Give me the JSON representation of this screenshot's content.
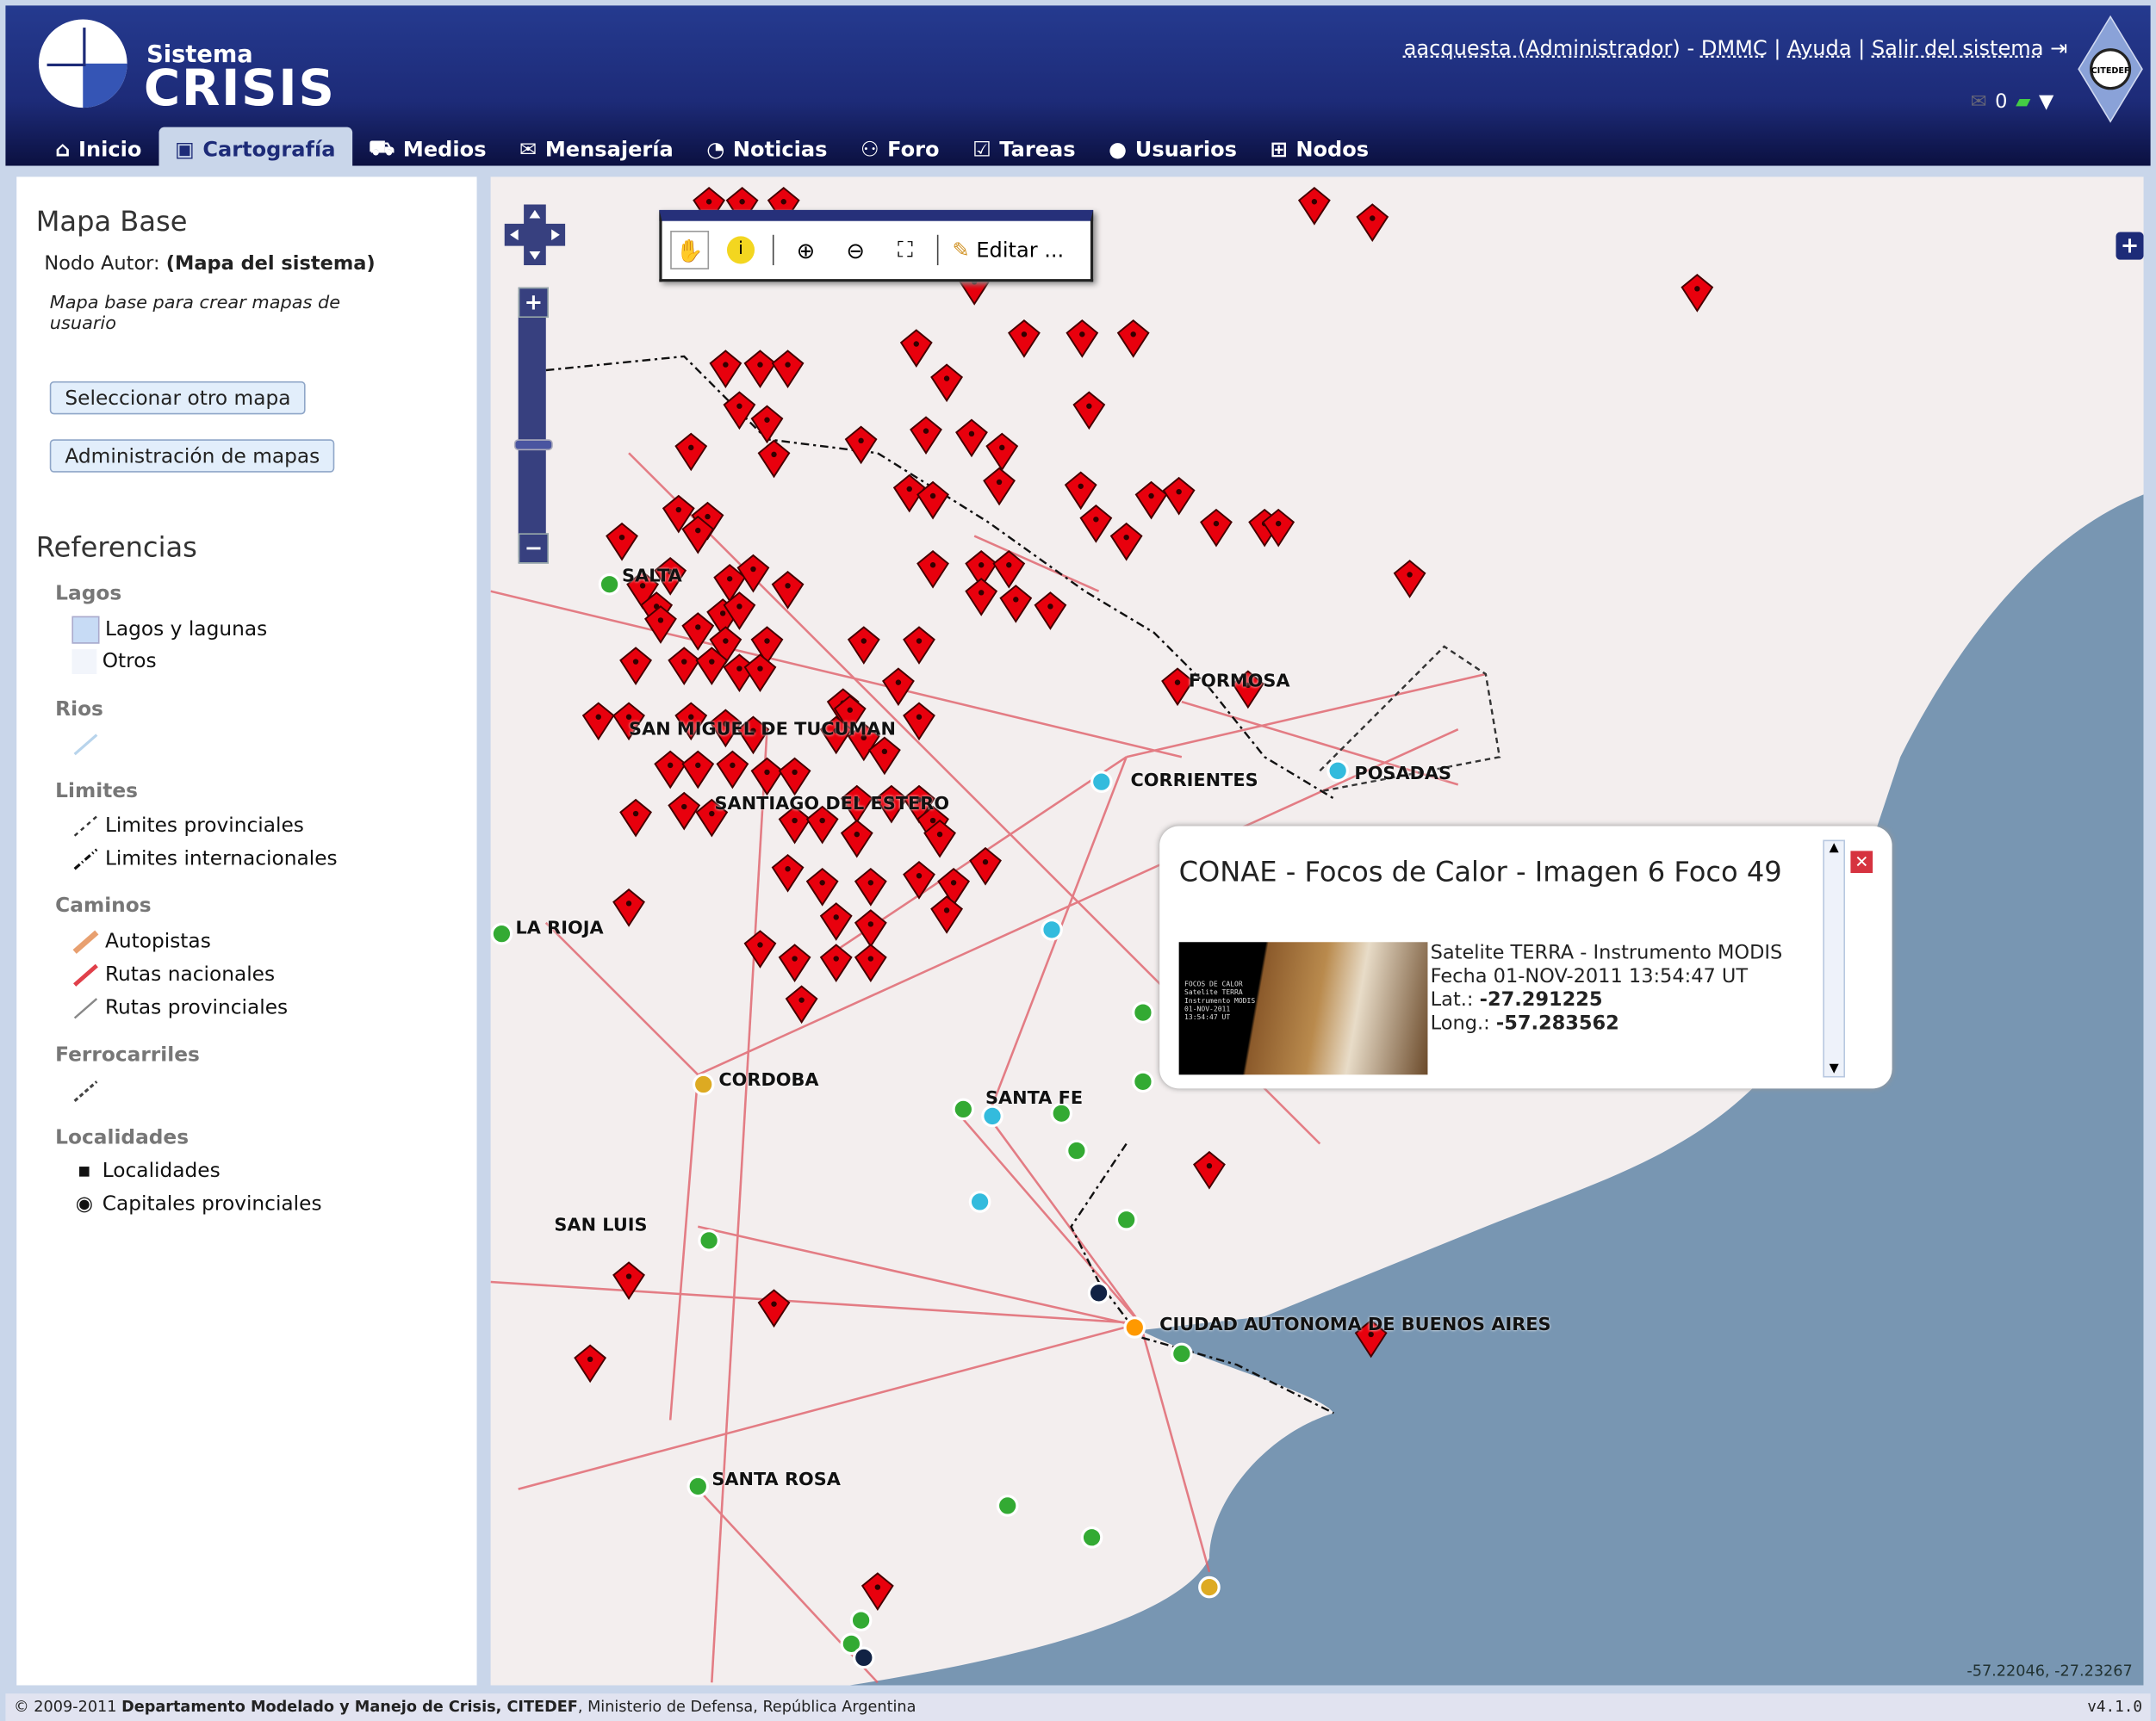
{
  "header": {
    "brand_small": "Sistema",
    "brand_big": "CRISIS",
    "user": "aacquesta (Administrador)",
    "node": "DMMC",
    "help": "Ayuda",
    "logout": "Salir del sistema",
    "separator1": " - ",
    "separator2": " | ",
    "messages_count": "0",
    "citedef_logo": "CITEDEF"
  },
  "tabs": [
    {
      "label": "Inicio",
      "icon": "home-icon"
    },
    {
      "label": "Cartografía",
      "icon": "map-icon"
    },
    {
      "label": "Medios",
      "icon": "vehicles-icon"
    },
    {
      "label": "Mensajería",
      "icon": "envelope-icon"
    },
    {
      "label": "Noticias",
      "icon": "rss-icon"
    },
    {
      "label": "Foro",
      "icon": "people-icon"
    },
    {
      "label": "Tareas",
      "icon": "checklist-icon"
    },
    {
      "label": "Usuarios",
      "icon": "user-icon"
    },
    {
      "label": "Nodos",
      "icon": "network-icon"
    }
  ],
  "sidebar": {
    "title": "Mapa Base",
    "author_label": "Nodo Autor:",
    "author_value": "(Mapa del sistema)",
    "description": "Mapa base para crear mapas de usuario",
    "select_button": "Seleccionar otro mapa",
    "admin_button": "Administración de mapas",
    "references_title": "Referencias",
    "groups": {
      "lagos": "Lagos",
      "lagos_items": [
        "Lagos y lagunas",
        "Otros"
      ],
      "rios": "Rios",
      "limites": "Limites",
      "limites_items": [
        "Limites provinciales",
        "Limites internacionales"
      ],
      "caminos": "Caminos",
      "caminos_items": [
        "Autopistas",
        "Rutas nacionales",
        "Rutas provinciales"
      ],
      "ferrocarriles": "Ferrocarriles",
      "localidades": "Localidades",
      "localidades_items": [
        "Localidades",
        "Capitales provinciales"
      ]
    }
  },
  "map": {
    "toolbar_edit": "Editar ...",
    "coords": "-57.22046, -27.23267",
    "cities": [
      "FORMOSA",
      "CORRIENTES",
      "POSADAS",
      "SAN MIGUEL DE TUCUMAN",
      "SANTIAGO DEL ESTERO",
      "LA RIOJA",
      "CORDOBA",
      "SANTA FE",
      "SAN LUIS",
      "CIUDAD AUTONOMA DE BUENOS AIRES",
      "SANTA ROSA",
      "SALTA"
    ],
    "colors": {
      "marker": "#e8000d",
      "land": "#f3eeee",
      "water": "#7896b2"
    }
  },
  "popup": {
    "title": "CONAE - Focos de Calor - Imagen 6 Foco 49",
    "line1": "Satelite TERRA - Instrumento MODIS",
    "line2": "Fecha 01-NOV-2011 13:54:47 UT",
    "lat_label": "Lat.:",
    "lat": "-27.291225",
    "long_label": "Long.:",
    "long": "-57.283562",
    "thumb_text": "FOCOS DE CALOR\nSatelite TERRA\nInstrumento MODIS\n01-NOV-2011\n13:54:47 UT"
  },
  "footer": {
    "copyright_prefix": "© 2009-2011 ",
    "org": "Departamento Modelado y Manejo de Crisis, CITEDEF",
    "rest": ", Ministerio de Defensa, República Argentina",
    "version": "v4.1.0"
  }
}
